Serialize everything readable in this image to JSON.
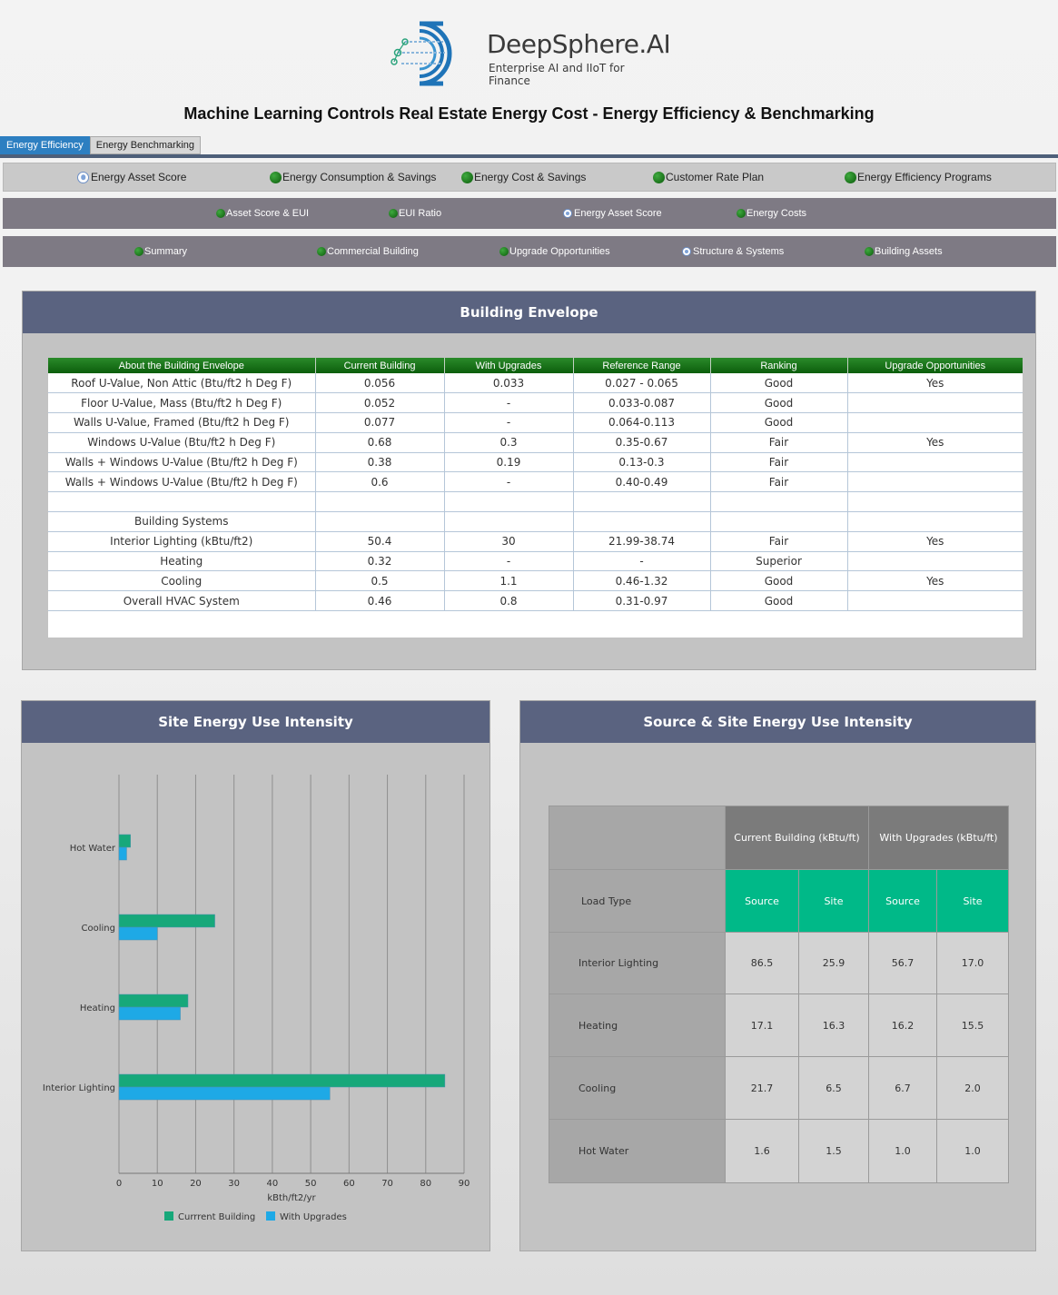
{
  "brand": {
    "name": "DeepSphere.AI",
    "tagline": "Enterprise AI and IIoT for Finance"
  },
  "title": "Machine Learning Controls Real Estate Energy Cost - Energy Efficiency & Benchmarking",
  "tabs": [
    {
      "label": "Energy Efficiency",
      "active": true
    },
    {
      "label": "Energy Benchmarking",
      "active": false
    }
  ],
  "nav_level1": [
    {
      "label": "Energy Asset Score",
      "selected": true
    },
    {
      "label": "Energy Consumption & Savings",
      "selected": false
    },
    {
      "label": "Energy Cost & Savings",
      "selected": false
    },
    {
      "label": "Customer Rate Plan",
      "selected": false
    },
    {
      "label": "Energy Efficiency Programs",
      "selected": false
    }
  ],
  "nav_level2": [
    {
      "label": "Asset Score & EUI",
      "selected": false
    },
    {
      "label": "EUI Ratio",
      "selected": false
    },
    {
      "label": "Energy Asset Score",
      "selected": true
    },
    {
      "label": "Energy Costs",
      "selected": false
    }
  ],
  "nav_level3": [
    {
      "label": "Summary",
      "selected": false
    },
    {
      "label": "Commercial Building",
      "selected": false
    },
    {
      "label": "Upgrade Opportunities",
      "selected": false
    },
    {
      "label": "Structure & Systems",
      "selected": true
    },
    {
      "label": "Building Assets",
      "selected": false
    }
  ],
  "envelope": {
    "title": "Building Envelope",
    "columns": [
      "About the Building Envelope",
      "Current Building",
      "With Upgrades",
      "Reference Range",
      "Ranking",
      "Upgrade Opportunities"
    ],
    "rows": [
      [
        "Roof U-Value, Non Attic (Btu/ft2 h Deg F)",
        "0.056",
        "0.033",
        "0.027 - 0.065",
        "Good",
        "Yes"
      ],
      [
        "Floor U-Value, Mass (Btu/ft2 h Deg F)",
        "0.052",
        "-",
        "0.033-0.087",
        "Good",
        ""
      ],
      [
        "Walls U-Value, Framed (Btu/ft2 h Deg F)",
        "0.077",
        "-",
        "0.064-0.113",
        "Good",
        ""
      ],
      [
        "Windows U-Value (Btu/ft2 h Deg F)",
        "0.68",
        "0.3",
        "0.35-0.67",
        "Fair",
        "Yes"
      ],
      [
        "Walls + Windows U-Value (Btu/ft2 h Deg F)",
        "0.38",
        "0.19",
        "0.13-0.3",
        "Fair",
        ""
      ],
      [
        "Walls + Windows U-Value (Btu/ft2 h Deg F)",
        "0.6",
        "-",
        "0.40-0.49",
        "Fair",
        ""
      ],
      [
        "",
        "",
        "",
        "",
        "",
        ""
      ],
      [
        "Building Systems",
        "",
        "",
        "",
        "",
        ""
      ],
      [
        "Interior Lighting (kBtu/ft2)",
        "50.4",
        "30",
        "21.99-38.74",
        "Fair",
        "Yes"
      ],
      [
        "Heating",
        "0.32",
        "-",
        "-",
        "Superior",
        ""
      ],
      [
        "Cooling",
        "0.5",
        "1.1",
        "0.46-1.32",
        "Good",
        "Yes"
      ],
      [
        "Overall HVAC System",
        "0.46",
        "0.8",
        "0.31-0.97",
        "Good",
        ""
      ]
    ]
  },
  "site_eui": {
    "title": "Site Energy Use Intensity",
    "chart_data": {
      "type": "bar",
      "orientation": "horizontal",
      "categories": [
        "Hot Water",
        "Cooling",
        "Heating",
        "Interior Lighting"
      ],
      "series": [
        {
          "name": "Currrent Building",
          "color": "#17a87a",
          "values": [
            3,
            25,
            18,
            85
          ]
        },
        {
          "name": "With Upgrades",
          "color": "#1ea9e6",
          "values": [
            2,
            10,
            16,
            55
          ]
        }
      ],
      "xlabel": "kBth/ft2/yr",
      "xlim": [
        0,
        90
      ],
      "xticks": [
        0,
        10,
        20,
        30,
        40,
        50,
        60,
        70,
        80,
        90
      ],
      "grid": true,
      "legend": "bottom"
    }
  },
  "source_site": {
    "title": "Source & Site Energy Use Intensity",
    "group_headers": [
      "Current Building (kBtu/ft)",
      "With Upgrades (kBtu/ft)"
    ],
    "load_type_label": "Load Type",
    "sub_headers": [
      "Source",
      "Site",
      "Source",
      "Site"
    ],
    "rows": [
      {
        "label": "Interior Lighting",
        "values": [
          "86.5",
          "25.9",
          "56.7",
          "17.0"
        ]
      },
      {
        "label": "Heating",
        "values": [
          "17.1",
          "16.3",
          "16.2",
          "15.5"
        ]
      },
      {
        "label": "Cooling",
        "values": [
          "21.7",
          "6.5",
          "6.7",
          "2.0"
        ]
      },
      {
        "label": "Hot Water",
        "values": [
          "1.6",
          "1.5",
          "1.0",
          "1.0"
        ]
      }
    ]
  }
}
